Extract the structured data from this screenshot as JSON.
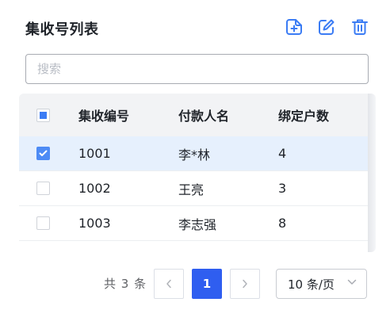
{
  "header": {
    "title": "集收号列表",
    "icons": {
      "add": "add-square-icon",
      "edit": "edit-icon",
      "delete": "trash-icon"
    },
    "accent": "#3b7cf4"
  },
  "search": {
    "placeholder": "搜索",
    "value": ""
  },
  "table": {
    "columns": [
      "集收编号",
      "付款人名",
      "绑定户数"
    ],
    "header_checkbox_state": "indeterminate",
    "rows": [
      {
        "id": "1001",
        "name": "李*林",
        "count": "4",
        "selected": true
      },
      {
        "id": "1002",
        "name": "王亮",
        "count": "3",
        "selected": false
      },
      {
        "id": "1003",
        "name": "李志强",
        "count": "8",
        "selected": false
      }
    ]
  },
  "pagination": {
    "total_text": "共 3 条",
    "current_page": "1",
    "page_size_label": "10 条/页",
    "primary_color": "#2f5ef0"
  }
}
